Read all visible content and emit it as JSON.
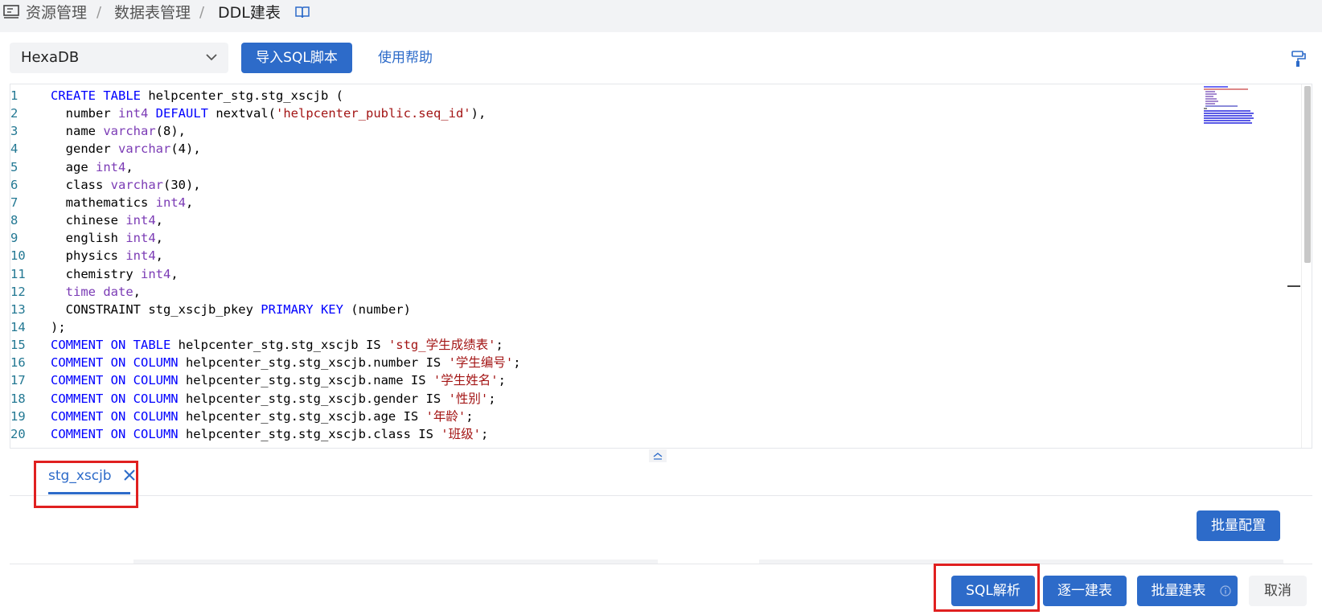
{
  "breadcrumb": {
    "items": [
      "资源管理",
      "数据表管理",
      "DDL建表"
    ],
    "separator": "/"
  },
  "toolbar": {
    "db_type": "HexaDB",
    "import_label": "导入SQL脚本",
    "help_label": "使用帮助"
  },
  "editor": {
    "line_numbers": [
      "1",
      "2",
      "3",
      "4",
      "5",
      "6",
      "7",
      "8",
      "9",
      "10",
      "11",
      "12",
      "13",
      "14",
      "15",
      "16",
      "17",
      "18",
      "19",
      "20"
    ],
    "lines": [
      [
        {
          "t": "kw",
          "v": "CREATE TABLE"
        },
        {
          "t": "p",
          "v": " helpcenter_stg.stg_xscjb ("
        }
      ],
      [
        {
          "t": "p",
          "v": "  number "
        },
        {
          "t": "ty",
          "v": "int4"
        },
        {
          "t": "p",
          "v": " "
        },
        {
          "t": "kw",
          "v": "DEFAULT"
        },
        {
          "t": "p",
          "v": " nextval("
        },
        {
          "t": "str",
          "v": "'helpcenter_public.seq_id'"
        },
        {
          "t": "p",
          "v": "),"
        }
      ],
      [
        {
          "t": "p",
          "v": "  name "
        },
        {
          "t": "ty",
          "v": "varchar"
        },
        {
          "t": "p",
          "v": "(8),"
        }
      ],
      [
        {
          "t": "p",
          "v": "  gender "
        },
        {
          "t": "ty",
          "v": "varchar"
        },
        {
          "t": "p",
          "v": "(4),"
        }
      ],
      [
        {
          "t": "p",
          "v": "  age "
        },
        {
          "t": "ty",
          "v": "int4"
        },
        {
          "t": "p",
          "v": ","
        }
      ],
      [
        {
          "t": "p",
          "v": "  class "
        },
        {
          "t": "ty",
          "v": "varchar"
        },
        {
          "t": "p",
          "v": "(30),"
        }
      ],
      [
        {
          "t": "p",
          "v": "  mathematics "
        },
        {
          "t": "ty",
          "v": "int4"
        },
        {
          "t": "p",
          "v": ","
        }
      ],
      [
        {
          "t": "p",
          "v": "  chinese "
        },
        {
          "t": "ty",
          "v": "int4"
        },
        {
          "t": "p",
          "v": ","
        }
      ],
      [
        {
          "t": "p",
          "v": "  english "
        },
        {
          "t": "ty",
          "v": "int4"
        },
        {
          "t": "p",
          "v": ","
        }
      ],
      [
        {
          "t": "p",
          "v": "  physics "
        },
        {
          "t": "ty",
          "v": "int4"
        },
        {
          "t": "p",
          "v": ","
        }
      ],
      [
        {
          "t": "p",
          "v": "  chemistry "
        },
        {
          "t": "ty",
          "v": "int4"
        },
        {
          "t": "p",
          "v": ","
        }
      ],
      [
        {
          "t": "p",
          "v": "  "
        },
        {
          "t": "ty",
          "v": "time date"
        },
        {
          "t": "p",
          "v": ","
        }
      ],
      [
        {
          "t": "p",
          "v": "  CONSTRAINT stg_xscjb_pkey "
        },
        {
          "t": "kw",
          "v": "PRIMARY KEY"
        },
        {
          "t": "p",
          "v": " (number)"
        }
      ],
      [
        {
          "t": "p",
          "v": ");"
        }
      ],
      [
        {
          "t": "kw",
          "v": "COMMENT ON TABLE"
        },
        {
          "t": "p",
          "v": " helpcenter_stg.stg_xscjb IS "
        },
        {
          "t": "str",
          "v": "'stg_学生成绩表'"
        },
        {
          "t": "p",
          "v": ";"
        }
      ],
      [
        {
          "t": "kw",
          "v": "COMMENT ON COLUMN"
        },
        {
          "t": "p",
          "v": " helpcenter_stg.stg_xscjb.number IS "
        },
        {
          "t": "str",
          "v": "'学生编号'"
        },
        {
          "t": "p",
          "v": ";"
        }
      ],
      [
        {
          "t": "kw",
          "v": "COMMENT ON COLUMN"
        },
        {
          "t": "p",
          "v": " helpcenter_stg.stg_xscjb.name IS "
        },
        {
          "t": "str",
          "v": "'学生姓名'"
        },
        {
          "t": "p",
          "v": ";"
        }
      ],
      [
        {
          "t": "kw",
          "v": "COMMENT ON COLUMN"
        },
        {
          "t": "p",
          "v": " helpcenter_stg.stg_xscjb.gender IS "
        },
        {
          "t": "str",
          "v": "'性别'"
        },
        {
          "t": "p",
          "v": ";"
        }
      ],
      [
        {
          "t": "kw",
          "v": "COMMENT ON COLUMN"
        },
        {
          "t": "p",
          "v": " helpcenter_stg.stg_xscjb.age IS "
        },
        {
          "t": "str",
          "v": "'年龄'"
        },
        {
          "t": "p",
          "v": ";"
        }
      ],
      [
        {
          "t": "kw",
          "v": "COMMENT ON COLUMN"
        },
        {
          "t": "p",
          "v": " helpcenter_stg.stg_xscjb.class IS "
        },
        {
          "t": "str",
          "v": "'班级'"
        },
        {
          "t": "p",
          "v": ";"
        }
      ]
    ]
  },
  "tabs": [
    {
      "label": "stg_xscjb",
      "active": true
    }
  ],
  "actions": {
    "batch_config": "批量配置",
    "sql_parse": "SQL解析",
    "create_one_by_one": "逐一建表",
    "batch_create": "批量建表",
    "cancel": "取消"
  },
  "colors": {
    "primary": "#2d6bc9",
    "highlight_box": "#e02020",
    "keyword": "#0000ff",
    "type": "#7b3bb5",
    "string": "#a31515",
    "line_number": "#237893"
  },
  "icons": {
    "home": "monitor-icon",
    "doc": "book-icon",
    "select": "chevron-down-icon",
    "format": "paint-roller-icon",
    "tab_close": "close-icon",
    "collapse": "collapse-up-icon",
    "info": "info-icon"
  }
}
